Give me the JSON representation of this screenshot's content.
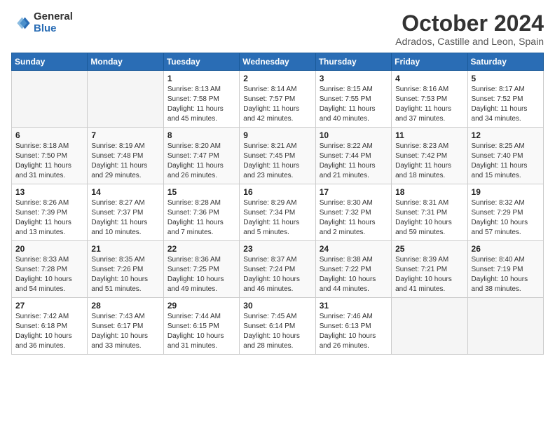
{
  "header": {
    "logo_general": "General",
    "logo_blue": "Blue",
    "month_title": "October 2024",
    "subtitle": "Adrados, Castille and Leon, Spain"
  },
  "calendar": {
    "days_of_week": [
      "Sunday",
      "Monday",
      "Tuesday",
      "Wednesday",
      "Thursday",
      "Friday",
      "Saturday"
    ],
    "weeks": [
      [
        {
          "day": "",
          "info": ""
        },
        {
          "day": "",
          "info": ""
        },
        {
          "day": "1",
          "info": "Sunrise: 8:13 AM\nSunset: 7:58 PM\nDaylight: 11 hours and 45 minutes."
        },
        {
          "day": "2",
          "info": "Sunrise: 8:14 AM\nSunset: 7:57 PM\nDaylight: 11 hours and 42 minutes."
        },
        {
          "day": "3",
          "info": "Sunrise: 8:15 AM\nSunset: 7:55 PM\nDaylight: 11 hours and 40 minutes."
        },
        {
          "day": "4",
          "info": "Sunrise: 8:16 AM\nSunset: 7:53 PM\nDaylight: 11 hours and 37 minutes."
        },
        {
          "day": "5",
          "info": "Sunrise: 8:17 AM\nSunset: 7:52 PM\nDaylight: 11 hours and 34 minutes."
        }
      ],
      [
        {
          "day": "6",
          "info": "Sunrise: 8:18 AM\nSunset: 7:50 PM\nDaylight: 11 hours and 31 minutes."
        },
        {
          "day": "7",
          "info": "Sunrise: 8:19 AM\nSunset: 7:48 PM\nDaylight: 11 hours and 29 minutes."
        },
        {
          "day": "8",
          "info": "Sunrise: 8:20 AM\nSunset: 7:47 PM\nDaylight: 11 hours and 26 minutes."
        },
        {
          "day": "9",
          "info": "Sunrise: 8:21 AM\nSunset: 7:45 PM\nDaylight: 11 hours and 23 minutes."
        },
        {
          "day": "10",
          "info": "Sunrise: 8:22 AM\nSunset: 7:44 PM\nDaylight: 11 hours and 21 minutes."
        },
        {
          "day": "11",
          "info": "Sunrise: 8:23 AM\nSunset: 7:42 PM\nDaylight: 11 hours and 18 minutes."
        },
        {
          "day": "12",
          "info": "Sunrise: 8:25 AM\nSunset: 7:40 PM\nDaylight: 11 hours and 15 minutes."
        }
      ],
      [
        {
          "day": "13",
          "info": "Sunrise: 8:26 AM\nSunset: 7:39 PM\nDaylight: 11 hours and 13 minutes."
        },
        {
          "day": "14",
          "info": "Sunrise: 8:27 AM\nSunset: 7:37 PM\nDaylight: 11 hours and 10 minutes."
        },
        {
          "day": "15",
          "info": "Sunrise: 8:28 AM\nSunset: 7:36 PM\nDaylight: 11 hours and 7 minutes."
        },
        {
          "day": "16",
          "info": "Sunrise: 8:29 AM\nSunset: 7:34 PM\nDaylight: 11 hours and 5 minutes."
        },
        {
          "day": "17",
          "info": "Sunrise: 8:30 AM\nSunset: 7:32 PM\nDaylight: 11 hours and 2 minutes."
        },
        {
          "day": "18",
          "info": "Sunrise: 8:31 AM\nSunset: 7:31 PM\nDaylight: 10 hours and 59 minutes."
        },
        {
          "day": "19",
          "info": "Sunrise: 8:32 AM\nSunset: 7:29 PM\nDaylight: 10 hours and 57 minutes."
        }
      ],
      [
        {
          "day": "20",
          "info": "Sunrise: 8:33 AM\nSunset: 7:28 PM\nDaylight: 10 hours and 54 minutes."
        },
        {
          "day": "21",
          "info": "Sunrise: 8:35 AM\nSunset: 7:26 PM\nDaylight: 10 hours and 51 minutes."
        },
        {
          "day": "22",
          "info": "Sunrise: 8:36 AM\nSunset: 7:25 PM\nDaylight: 10 hours and 49 minutes."
        },
        {
          "day": "23",
          "info": "Sunrise: 8:37 AM\nSunset: 7:24 PM\nDaylight: 10 hours and 46 minutes."
        },
        {
          "day": "24",
          "info": "Sunrise: 8:38 AM\nSunset: 7:22 PM\nDaylight: 10 hours and 44 minutes."
        },
        {
          "day": "25",
          "info": "Sunrise: 8:39 AM\nSunset: 7:21 PM\nDaylight: 10 hours and 41 minutes."
        },
        {
          "day": "26",
          "info": "Sunrise: 8:40 AM\nSunset: 7:19 PM\nDaylight: 10 hours and 38 minutes."
        }
      ],
      [
        {
          "day": "27",
          "info": "Sunrise: 7:42 AM\nSunset: 6:18 PM\nDaylight: 10 hours and 36 minutes."
        },
        {
          "day": "28",
          "info": "Sunrise: 7:43 AM\nSunset: 6:17 PM\nDaylight: 10 hours and 33 minutes."
        },
        {
          "day": "29",
          "info": "Sunrise: 7:44 AM\nSunset: 6:15 PM\nDaylight: 10 hours and 31 minutes."
        },
        {
          "day": "30",
          "info": "Sunrise: 7:45 AM\nSunset: 6:14 PM\nDaylight: 10 hours and 28 minutes."
        },
        {
          "day": "31",
          "info": "Sunrise: 7:46 AM\nSunset: 6:13 PM\nDaylight: 10 hours and 26 minutes."
        },
        {
          "day": "",
          "info": ""
        },
        {
          "day": "",
          "info": ""
        }
      ]
    ]
  }
}
